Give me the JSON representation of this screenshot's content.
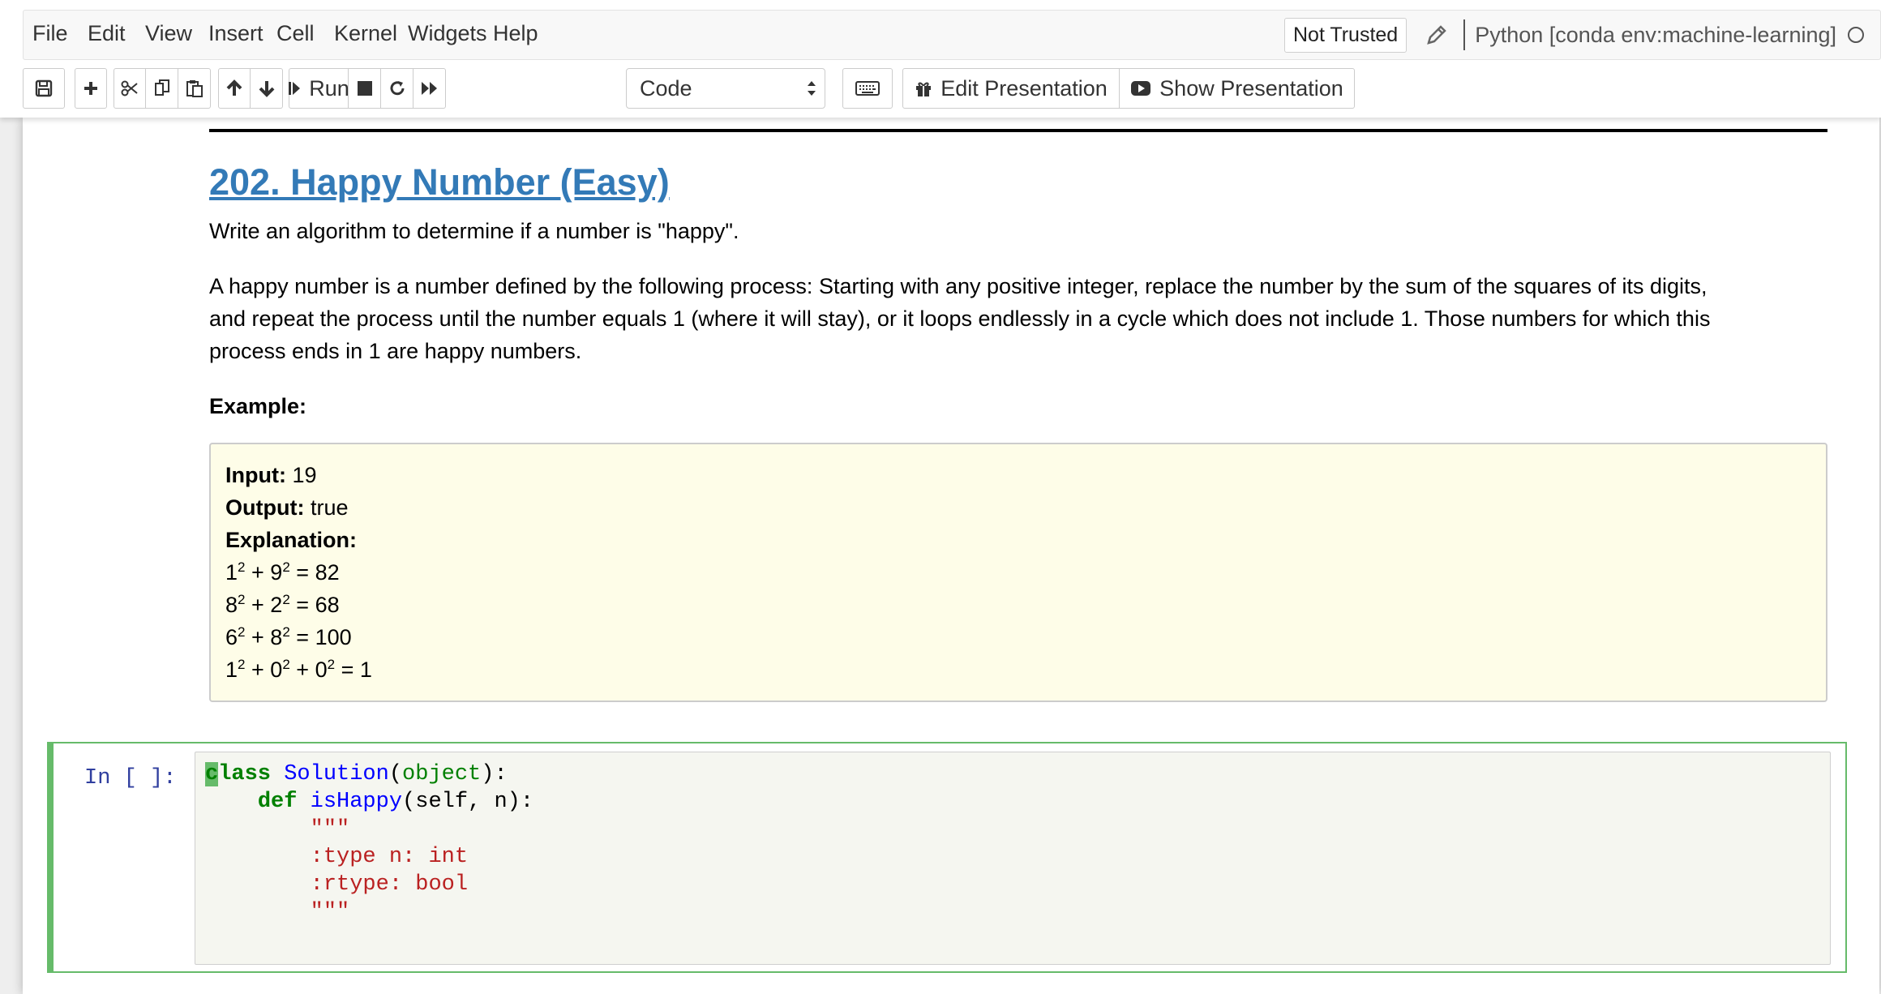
{
  "menubar": {
    "items": [
      "File",
      "Edit",
      "View",
      "Insert",
      "Cell",
      "Kernel",
      "Widgets",
      "Help"
    ],
    "trust_label": "Not Trusted",
    "kernel_name": "Python [conda env:machine-learning]"
  },
  "toolbar": {
    "run_label": "Run",
    "cell_type": "Code",
    "edit_presentation_label": "Edit Presentation",
    "show_presentation_label": "Show Presentation",
    "icons": [
      "save-icon",
      "plus-icon",
      "cut-icon",
      "copy-icon",
      "paste-icon",
      "arrow-up-icon",
      "arrow-down-icon",
      "run-icon",
      "stop-icon",
      "restart-icon",
      "fast-forward-icon",
      "keyboard-icon",
      "gift-icon",
      "youtube-play-icon"
    ]
  },
  "markdown": {
    "title": "202. Happy Number (Easy)",
    "intro": "Write an algorithm to determine if a number is \"happy\".",
    "description_lines": [
      "A happy number is a number defined by the following process: Starting with any positive integer, replace the number by the sum of the squares of its digits,",
      "and repeat the process until the number equals 1 (where it will stay), or it loops endlessly in a cycle which does not include 1. Those numbers for which this",
      "process ends in 1 are happy numbers."
    ],
    "example_heading": "Example:"
  },
  "example": {
    "input_label": "Input:",
    "input_value": " 19",
    "output_label": "Output:",
    "output_value": " true",
    "explanation_label": "Explanation:",
    "steps": [
      {
        "a": "1",
        "b": "9",
        "c": "",
        "result": "82"
      },
      {
        "a": "8",
        "b": "2",
        "c": "",
        "result": "68"
      },
      {
        "a": "6",
        "b": "8",
        "c": "",
        "result": "100"
      },
      {
        "a": "1",
        "b": "0",
        "c": "0",
        "result": "1"
      }
    ]
  },
  "code_cell": {
    "prompt": "In [ ]:",
    "line1": {
      "kw": "class",
      "name": "Solution",
      "paren_open": "(",
      "base": "object",
      "rest": "):"
    },
    "line2": {
      "indent": "    ",
      "kw": "def",
      "name": "isHappy",
      "rest": "(self, n):"
    },
    "docstring": [
      "        \"\"\"",
      "        :type n: int",
      "        :rtype: bool",
      "        \"\"\""
    ]
  },
  "colors": {
    "link": "#337ab7",
    "example_bg": "#fefde8",
    "cell_border_active": "#66bb6a",
    "prompt": "#303f9f"
  }
}
